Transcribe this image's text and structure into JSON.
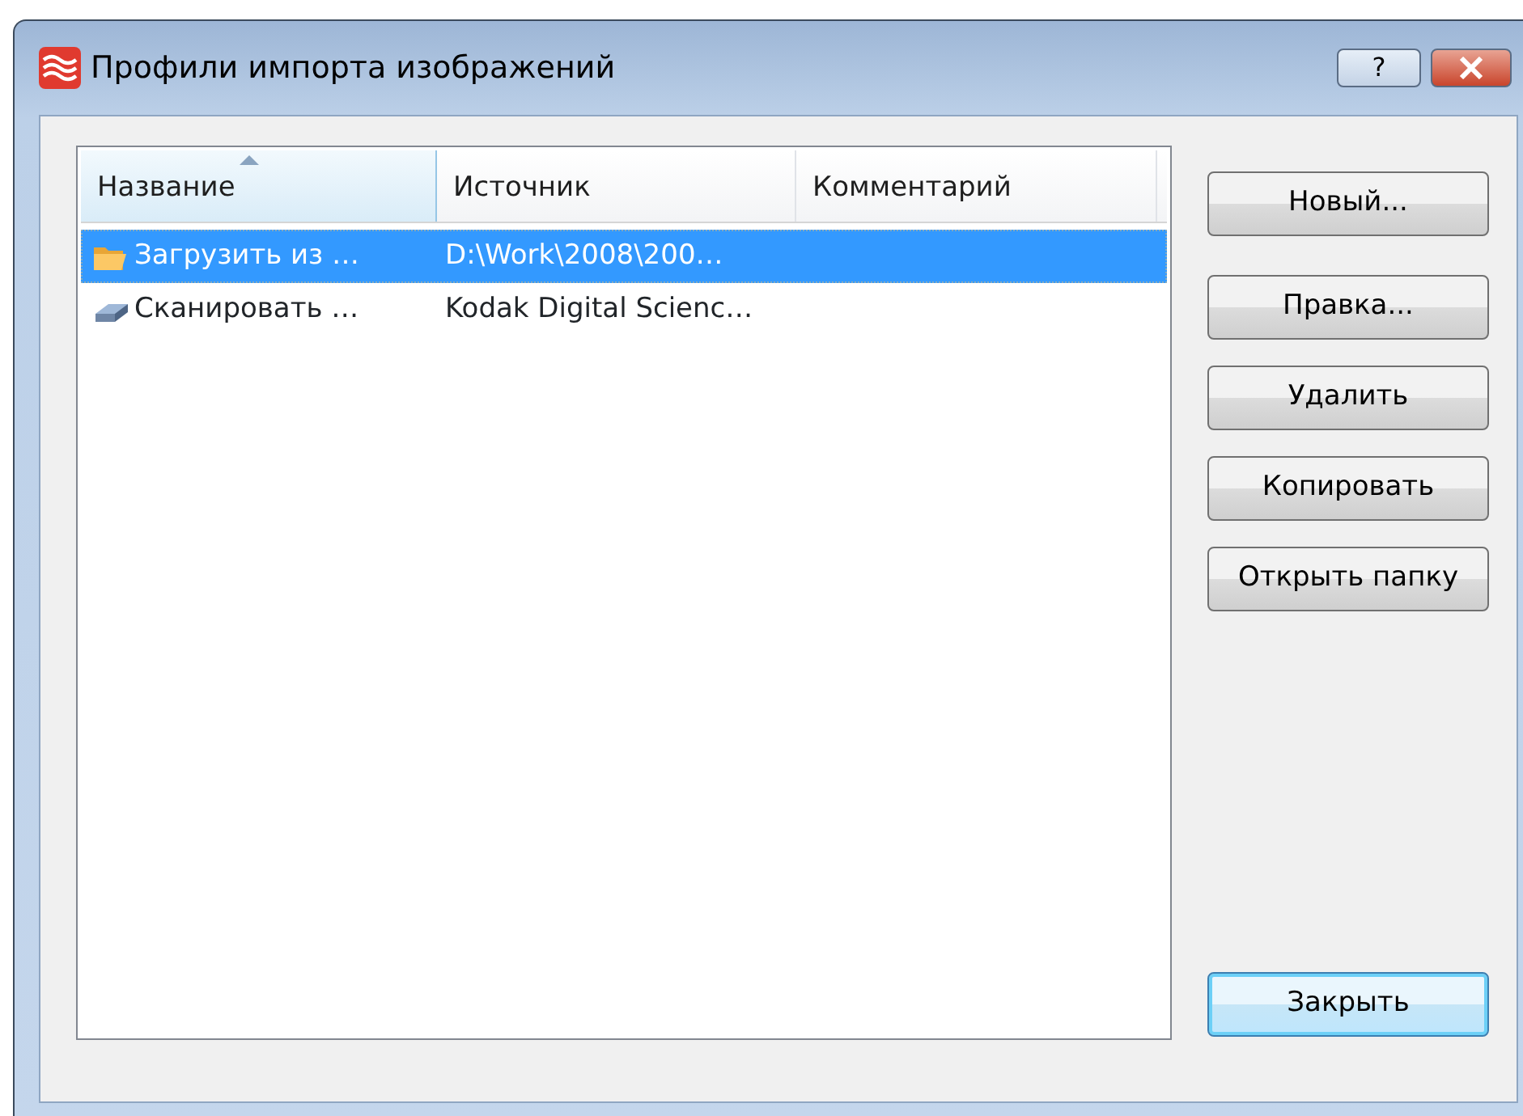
{
  "window": {
    "title": "Профили импорта изображений",
    "help_button": "?"
  },
  "table": {
    "columns": [
      {
        "label": "Название",
        "sorted": true
      },
      {
        "label": "Источник",
        "sorted": false
      },
      {
        "label": "Комментарий",
        "sorted": false
      }
    ],
    "rows": [
      {
        "kind": "folder",
        "name": "Загрузить из …",
        "source": "D:\\Work\\2008\\200…",
        "selected": true
      },
      {
        "kind": "scanner",
        "name": "Сканировать …",
        "source": "Kodak Digital Scienc…",
        "selected": false
      }
    ]
  },
  "buttons": [
    {
      "label": "Новый...",
      "default": false
    },
    {
      "label": "Правка...",
      "default": false
    },
    {
      "label": "Удалить",
      "default": false
    },
    {
      "label": "Копировать",
      "default": false
    },
    {
      "label": "Открыть папку",
      "default": false
    }
  ],
  "close_button": {
    "label": "Закрыть",
    "default": true
  }
}
